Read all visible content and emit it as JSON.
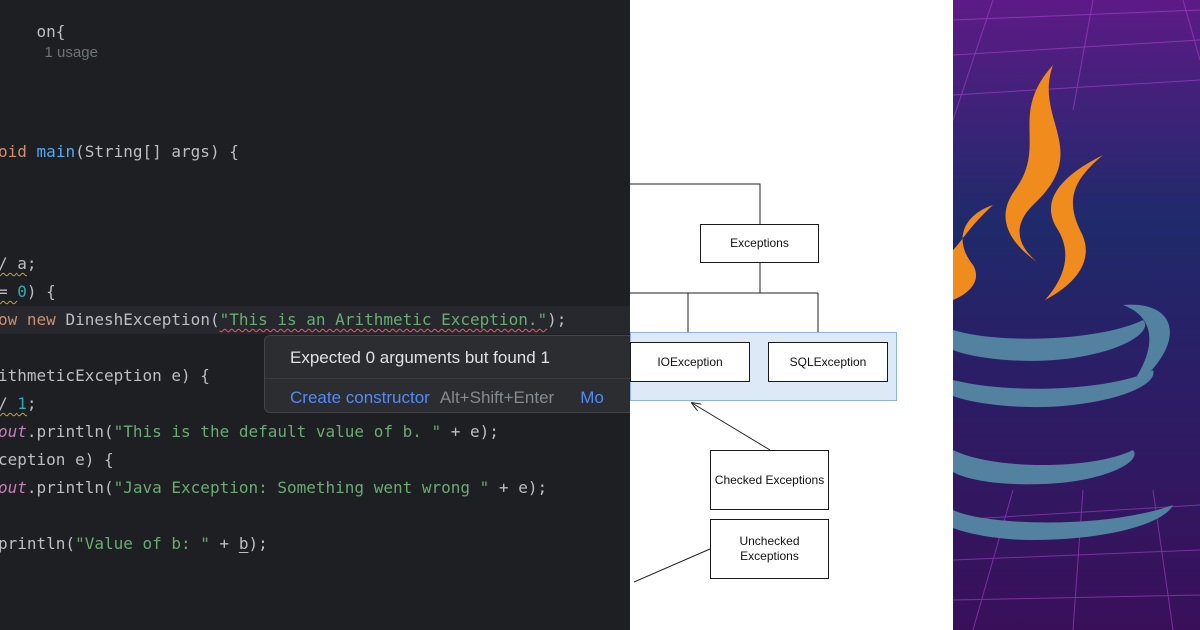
{
  "editor": {
    "line1": {
      "prefix": "on{",
      "usage": "1 usage"
    },
    "line2": {
      "kw": "oid",
      "fn": "main",
      "rest": "(String[] args) {"
    },
    "line3": {
      "lead": "/ ",
      "var": "a",
      "tail": ";"
    },
    "line4": {
      "lead": "= ",
      "num": "0",
      "tail": ") {"
    },
    "line5": {
      "kw1": "ow",
      "kw2": "new",
      "cls": "DineshException(",
      "str": "\"This is an Arithmetic Exception.\"",
      "tail": ");"
    },
    "line6": {
      "text": "ithmeticException e) {"
    },
    "line7": {
      "lead": "/ ",
      "num": "1",
      "tail": ";"
    },
    "line8": {
      "field": "out",
      "call": ".println(",
      "str": "\"This is the default value of b. \"",
      "tail": " + e);"
    },
    "line9": {
      "text": "ception e) {"
    },
    "line10": {
      "field": "out",
      "call": ".println(",
      "str": "\"Java Exception: Something went wrong \"",
      "tail": " + e);"
    },
    "line11": {
      "call": "println(",
      "str": "\"Value of b: \"",
      "mid": " + ",
      "var": "b",
      "tail": ");"
    }
  },
  "popup": {
    "message": "Expected 0 arguments but found 1",
    "action_label": "Create constructor",
    "shortcut": "Alt+Shift+Enter",
    "more_label": "Mo"
  },
  "diagram": {
    "exceptions": "Exceptions",
    "io": "IOException",
    "sql": "SQLException",
    "checked": "Checked Exceptions",
    "unchecked_line1": "Unchecked",
    "unchecked_line2": "Exceptions"
  },
  "colors": {
    "editor_bg": "#1e1f22",
    "keyword": "#cf8e6d",
    "function": "#56a8f5",
    "string": "#6aab73",
    "number": "#2aacb8",
    "field": "#c77dbb",
    "link": "#548af7",
    "java_orange": "#f08c1d",
    "java_blue": "#5382a1"
  },
  "logo": {
    "name": "java-logo-icon"
  }
}
